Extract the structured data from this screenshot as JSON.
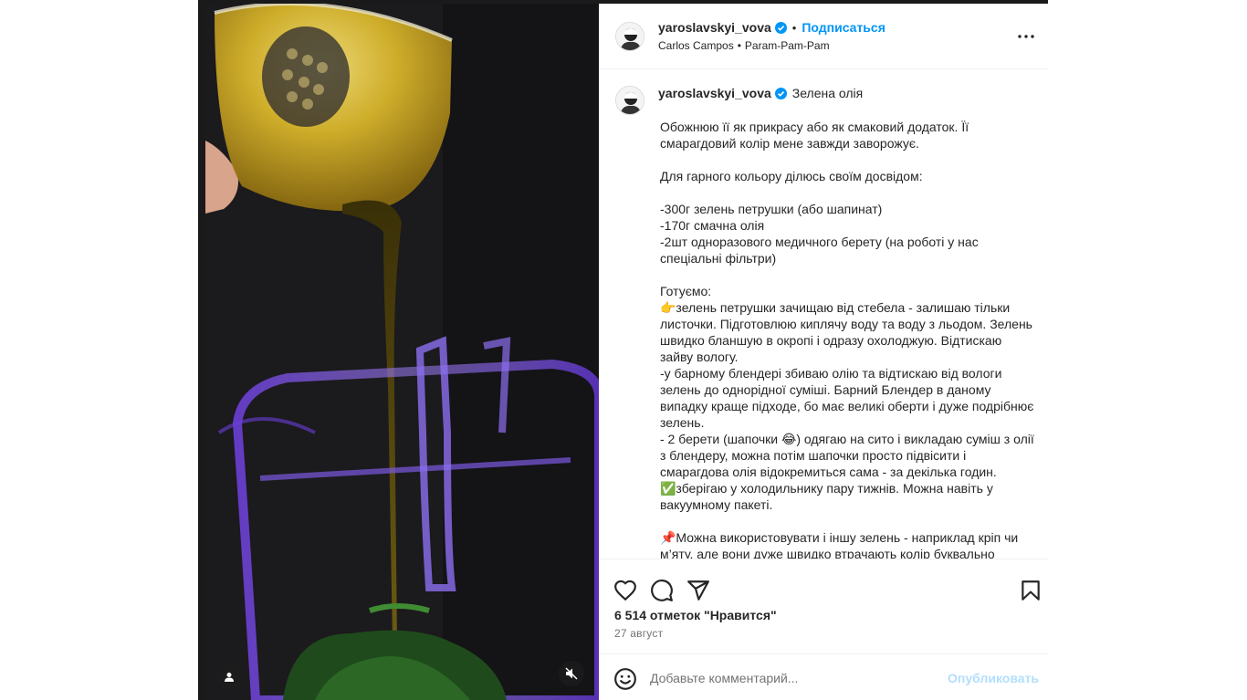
{
  "post": {
    "author": "yaroslavskyi_vova",
    "follow_label": "Подписаться",
    "separator": "•",
    "music_artist": "Carlos Campos",
    "music_track": "Param-Pam-Pam",
    "more_icon": "more-horizontal-icon"
  },
  "caption": {
    "author": "yaroslavskyi_vova",
    "title": "Зелена олія",
    "body": "Обожнюю її як прикрасу або як смаковий додаток. Її смарагдовий колір мене завжди заворожує.\n\nДля гарного кольору ділюсь своїм досвідом:\n\n-300г зелень петрушки (або шапинат)\n-170г смачна олія\n-2шт одноразового медичного берету (на роботі у нас спеціальні фільтри)\n\nГотуємо:\n👉зелень петрушки зачищаю від стебела - залишаю тільки листочки. Підготовлюю киплячу воду та воду з льодом. Зелень швидко бланшую в окропі і одразу охолоджую. Відтискаю зайву вологу.\n-у барному блендері збиваю олію та відтискаю від вологи зелень до однорідної суміші. Барний Блендер в даному випадку краще підходе, бо має великі оберти і дуже подрібнює зелень.\n- 2 берети (шапочки 😂) одягаю на сито і викладаю суміш з олії з блендеру, можна потім шапочки просто підвісити і смарагдова олія відокремиться сама - за декілька годин.\n✅зберігаю у холодильнику пару тижнів. Можна навіть у вакуумному пакеті.\n\n📌Можна використовувати і іншу зелень - наприклад кріп чи м’яту, але вони дуже швидко втрачають колір буквально"
  },
  "actions": {
    "like_icon": "heart-icon",
    "comment_icon": "comment-icon",
    "share_icon": "send-icon",
    "save_icon": "bookmark-icon"
  },
  "likes_text": "6 514 отметок \"Нравится\"",
  "date_text": "27 август",
  "comment": {
    "placeholder": "Добавьте комментарий...",
    "publish_label": "Опубликовать",
    "emoji_icon": "emoji-icon"
  },
  "media": {
    "tag_icon": "user-tag-icon",
    "mute_icon": "muted-speaker-icon"
  },
  "colors": {
    "accent": "#0095f6",
    "publish_disabled": "#b2dffc",
    "muted_text": "#737373"
  }
}
